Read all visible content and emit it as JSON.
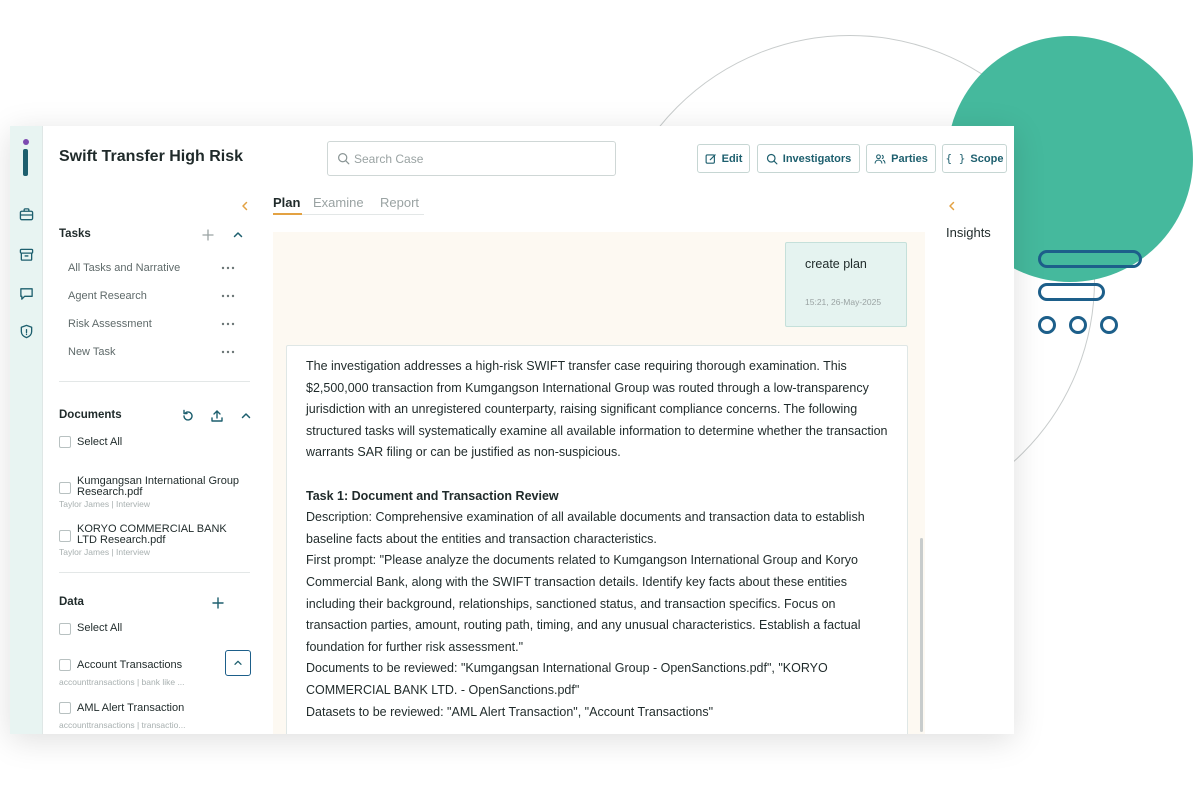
{
  "app": {
    "title": "Swift Transfer High Risk"
  },
  "search": {
    "placeholder": "Search Case"
  },
  "toolbar": {
    "edit_label": "Edit",
    "investigators_label": "Investigators",
    "parties_label": "Parties",
    "scope_label": "Scope"
  },
  "tabs": [
    {
      "label": "Plan",
      "active": true
    },
    {
      "label": "Examine",
      "active": false
    },
    {
      "label": "Report",
      "active": false
    }
  ],
  "sidebar": {
    "tasks": {
      "header": "Tasks",
      "items": [
        {
          "label": "All Tasks and Narrative"
        },
        {
          "label": "Agent Research"
        },
        {
          "label": "Risk Assessment"
        },
        {
          "label": "New Task"
        }
      ]
    },
    "documents": {
      "header": "Documents",
      "select_all": "Select All",
      "items": [
        {
          "name": "Kumgangsan International Group Research.pdf",
          "meta": "Taylor James | Interview"
        },
        {
          "name": "KORYO COMMERCIAL BANK LTD Research.pdf",
          "meta": "Taylor James | Interview"
        }
      ]
    },
    "data": {
      "header": "Data",
      "select_all": "Select All",
      "items": [
        {
          "name": "Account Transactions",
          "meta": "accounttransactions | bank like ..."
        },
        {
          "name": "AML Alert Transaction",
          "meta": "accounttransactions | transactio..."
        }
      ]
    }
  },
  "chat": {
    "user_message": {
      "text": "create plan",
      "timestamp": "15:21, 26-May-2025"
    },
    "response": {
      "intro": "The investigation addresses a high-risk SWIFT transfer case requiring thorough examination. This $2,500,000 transaction from Kumgangson International Group was routed through a low-transparency jurisdiction with an unregistered counterparty, raising significant compliance concerns. The following structured tasks will systematically examine all available information to determine whether the transaction warrants SAR filing or can be justified as non-suspicious.",
      "task1_title": "Task 1: Document and Transaction Review",
      "task1_description": "Description: Comprehensive examination of all available documents and transaction data to establish baseline facts about the entities and transaction characteristics.",
      "task1_prompt": "First prompt: \"Please analyze the documents related to Kumgangson International Group and Koryo Commercial Bank, along with the SWIFT transaction details. Identify key facts about these entities including their background, relationships, sanctioned status, and transaction specifics. Focus on transaction parties, amount, routing path, timing, and any unusual characteristics. Establish a factual foundation for further risk assessment.\"",
      "task1_documents": "Documents to be reviewed: \"Kumgangsan International Group - OpenSanctions.pdf\", \"KORYO COMMERCIAL BANK LTD. - OpenSanctions.pdf\"",
      "task1_datasets": "Datasets to be reviewed: \"AML Alert Transaction\", \"Account Transactions\""
    }
  },
  "right_panel": {
    "label": "Insights"
  },
  "colors": {
    "accent_teal": "#1d5f6e",
    "accent_orange": "#e3a243",
    "brand_green": "#45b99d",
    "brand_blue": "#1d5f8a",
    "chat_bg": "#fdf9f2",
    "rail_bg": "#e8f4f2"
  },
  "icons": {
    "rail": [
      "briefcase-icon",
      "archive-icon",
      "chat-icon",
      "shield-icon"
    ],
    "toolbar": [
      "edit-icon",
      "search-icon",
      "users-icon",
      "braces-icon"
    ]
  }
}
